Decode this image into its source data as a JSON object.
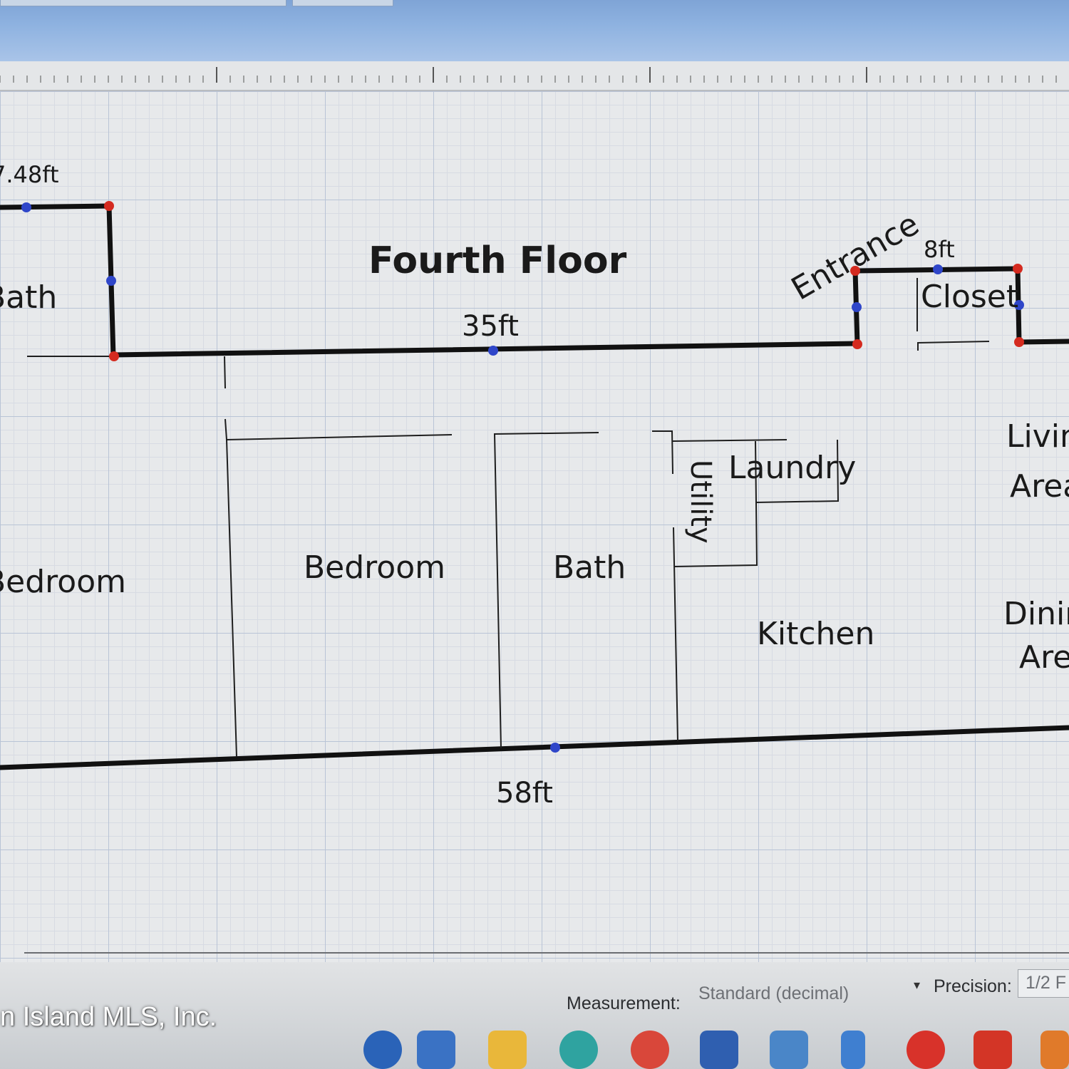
{
  "plan": {
    "title": "Fourth Floor",
    "dimensions": {
      "top_left": "7.48ft",
      "top_center": "35ft",
      "closet_width": "8ft",
      "bottom": "58ft"
    },
    "rooms": {
      "bath_left": "Bath",
      "bedroom_left": "Bedroom",
      "bedroom_center": "Bedroom",
      "bath_center": "Bath",
      "utility": "Utility",
      "laundry": "Laundry",
      "kitchen": "Kitchen",
      "entrance": "Entrance",
      "closet": "Closet",
      "living_line1": "Livin",
      "living_line2": "Area",
      "dining_line1": "Dinin",
      "dining_line2": "Are"
    }
  },
  "status": {
    "watermark": "n Island MLS, Inc.",
    "measurement_label": "Measurement:",
    "measurement_value": "Standard (decimal)",
    "precision_label": "Precision:",
    "precision_value": "1/2 F"
  },
  "taskbar": {
    "icons": [
      "info-icon",
      "mail-icon",
      "folder-icon",
      "edge-icon",
      "chrome-icon",
      "store-icon",
      "calculator-icon",
      "vscode-icon",
      "pinball-icon",
      "aci-icon",
      "warning-icon"
    ]
  },
  "colors": {
    "wall": "#111111",
    "endpoint_red": "#d42a1f",
    "midpoint_blue": "#2f46c9",
    "title_bar": "#8eb2e0"
  }
}
